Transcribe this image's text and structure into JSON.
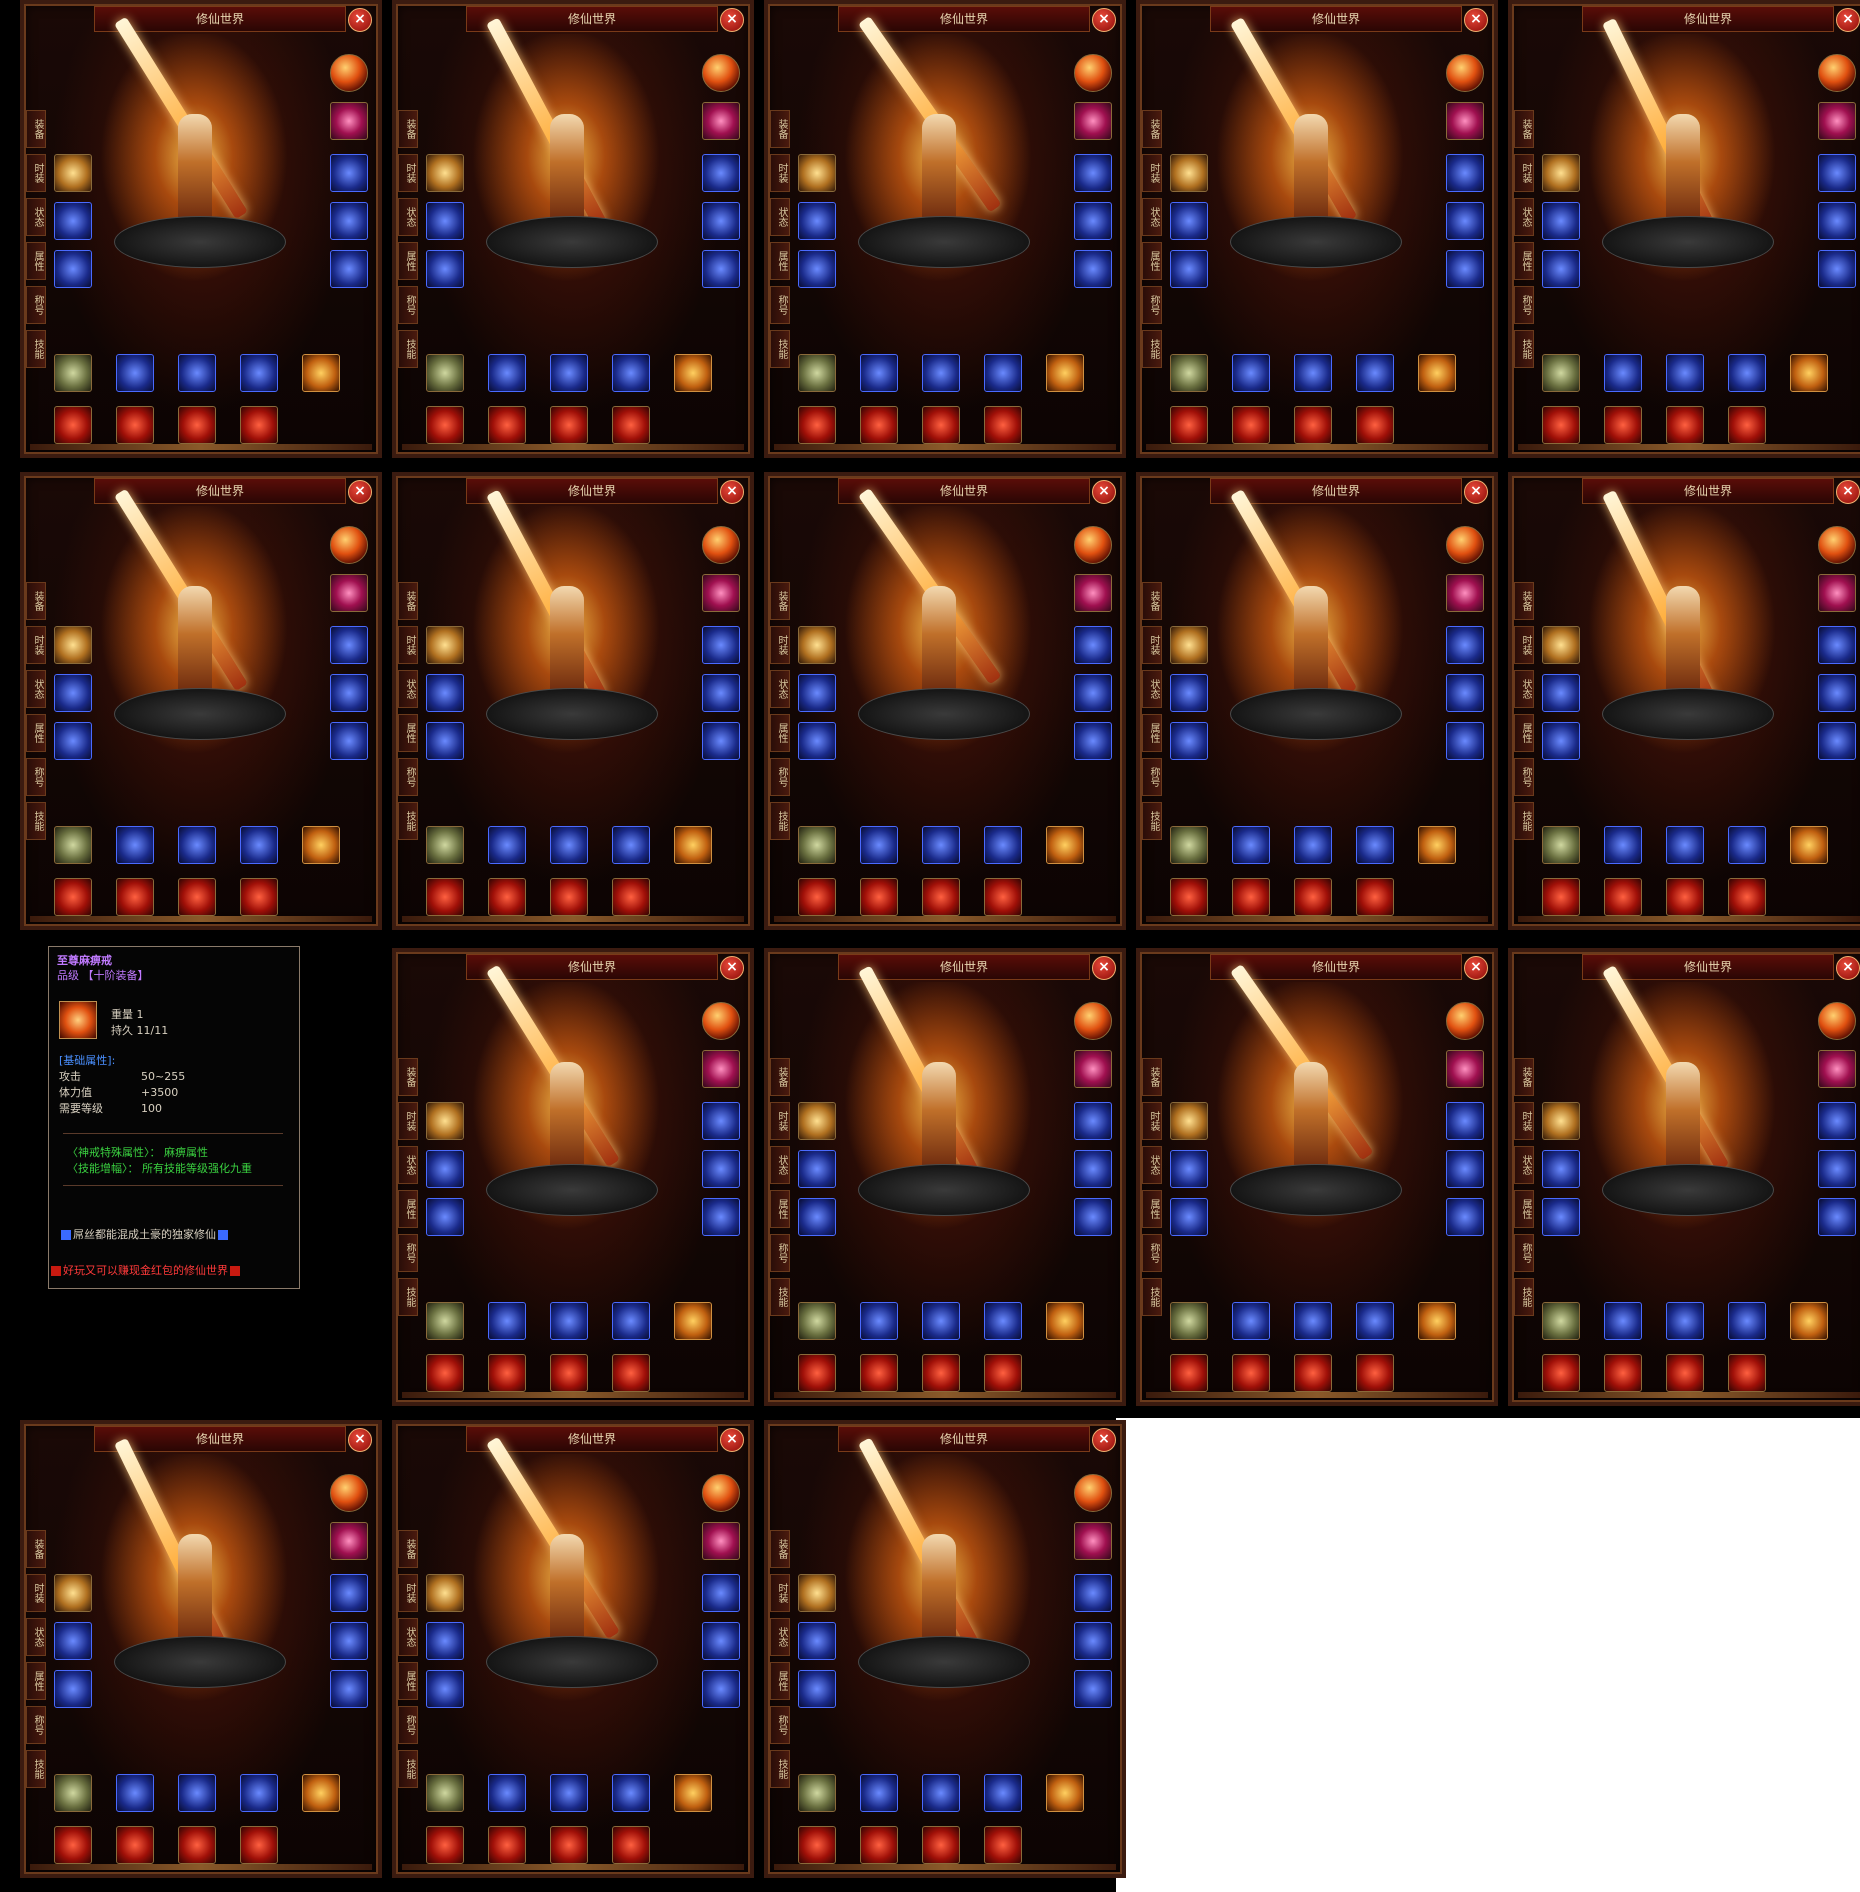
{
  "window_title": "修仙世界",
  "close_glyph": "×",
  "side_tabs": [
    "装备",
    "时装",
    "状态",
    "属性",
    "称号",
    "技能"
  ],
  "panel_count": 18,
  "tooltip": {
    "item_name": "至尊麻痹戒",
    "grade_label": "品级",
    "grade_value": "【十阶装备】",
    "weight_label": "重量",
    "weight_value": "1",
    "durability_label": "持久",
    "durability_value": "11/11",
    "base_attr_header": "[基础属性]:",
    "attack_label": "攻击",
    "attack_value": "50~255",
    "hp_label": "体力值",
    "hp_value": "+3500",
    "level_label": "需要等级",
    "level_value": "100",
    "special_label": "〈神戒特殊属性〉：",
    "special_value": "麻痹属性",
    "skill_label": "〈技能增幅〉：",
    "skill_value": "所有技能等级强化九重",
    "blue_line": "屌丝都能混成土豪的独家修仙",
    "red_line": "好玩又可以赚现金红包的修仙世界"
  },
  "colors": {
    "item_name": "#c07aff",
    "blue_text": "#4a90ff",
    "green_text": "#3ad040",
    "red_text": "#ff3a3a",
    "title_bar": "#5a0d08"
  }
}
